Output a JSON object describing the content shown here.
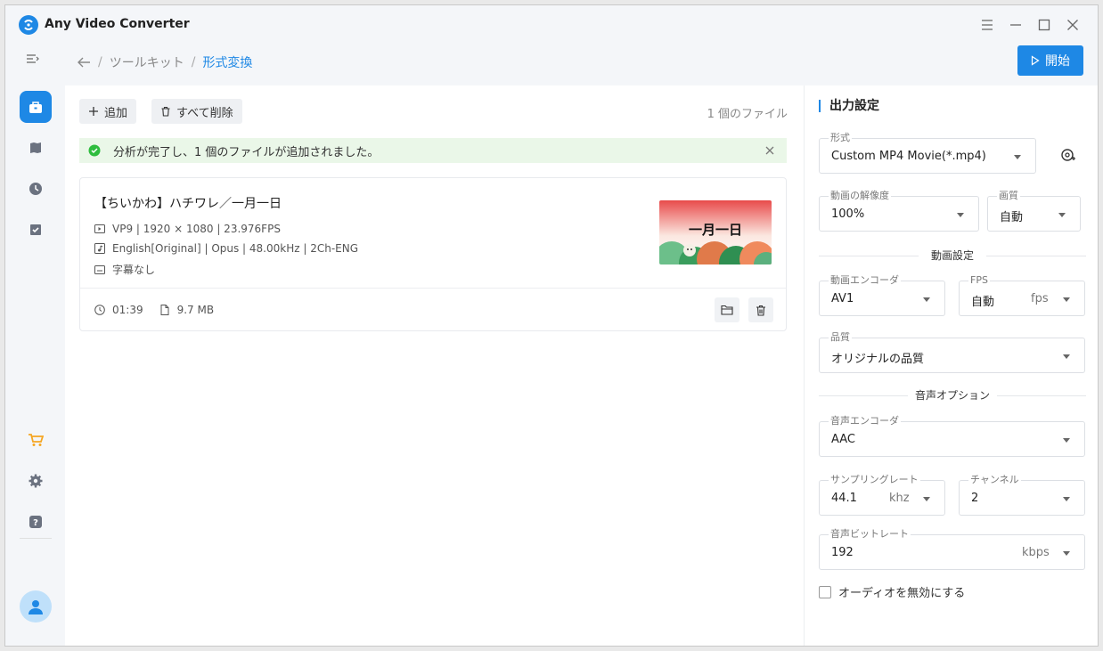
{
  "app": {
    "title": "Any Video Converter"
  },
  "header": {
    "breadcrumb": [
      "ツールキット",
      "形式変換"
    ],
    "start_label": "開始"
  },
  "toolbar": {
    "add_label": "追加",
    "delete_all_label": "すべて削除",
    "file_count": "1 個のファイル"
  },
  "alert": {
    "message": "分析が完了し、1 個のファイルが追加されました。"
  },
  "file": {
    "title": "【ちいかわ】ハチワレ／一月一日",
    "video_info": "VP9 | 1920 × 1080 | 23.976FPS",
    "audio_info": "English[Original] | Opus | 48.00kHz | 2Ch-ENG",
    "subtitle_info": "字幕なし",
    "duration": "01:39",
    "size": "9.7 MB",
    "thumb_text": "一月一日"
  },
  "settings": {
    "title": "出力設定",
    "format": {
      "label": "形式",
      "value": "Custom MP4 Movie(*.mp4)"
    },
    "resolution": {
      "label": "動画の解像度",
      "value": "100%"
    },
    "quality_small": {
      "label": "画質",
      "value": "自動"
    },
    "video_section": "動画設定",
    "video_encoder": {
      "label": "動画エンコーダ",
      "value": "AV1"
    },
    "fps": {
      "label": "FPS",
      "value": "自動",
      "unit": "fps"
    },
    "quality": {
      "label": "品質",
      "value": "オリジナルの品質"
    },
    "audio_section": "音声オプション",
    "audio_encoder": {
      "label": "音声エンコーダ",
      "value": "AAC"
    },
    "sample_rate": {
      "label": "サンプリングレート",
      "value": "44.1",
      "unit": "khz"
    },
    "channel": {
      "label": "チャンネル",
      "value": "2"
    },
    "audio_bitrate": {
      "label": "音声ビットレート",
      "value": "192",
      "unit": "kbps"
    },
    "disable_audio_label": "オーディオを無効にする"
  },
  "colors": {
    "accent": "#1e88e5",
    "success": "#2ebd3e",
    "cart": "#f5a623"
  }
}
